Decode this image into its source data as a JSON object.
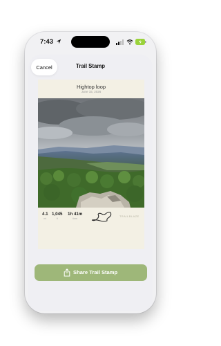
{
  "status_bar": {
    "time": "7:43",
    "icons": [
      "location-arrow-icon",
      "signal-icon",
      "wifi-icon",
      "battery-charging-icon"
    ]
  },
  "nav": {
    "cancel_label": "Cancel",
    "title": "Trail Stamp"
  },
  "stamp": {
    "trail_name": "Hightop loop",
    "date": "June 15, 2026",
    "photo": "mountain-overlook-photo",
    "stats": [
      {
        "value": "4.1",
        "label": "mi"
      },
      {
        "value": "1,045",
        "label": "ft"
      },
      {
        "value": "1h 41m",
        "label": "time"
      }
    ],
    "route_icon": "route-path-icon",
    "brand": "TRAILBLAZE"
  },
  "share": {
    "label": "Share Trail Stamp",
    "icon": "share-icon",
    "color": "#9eb779"
  },
  "colors": {
    "card_background": "#f3f0e4",
    "sheet_background": "#efeff3"
  }
}
